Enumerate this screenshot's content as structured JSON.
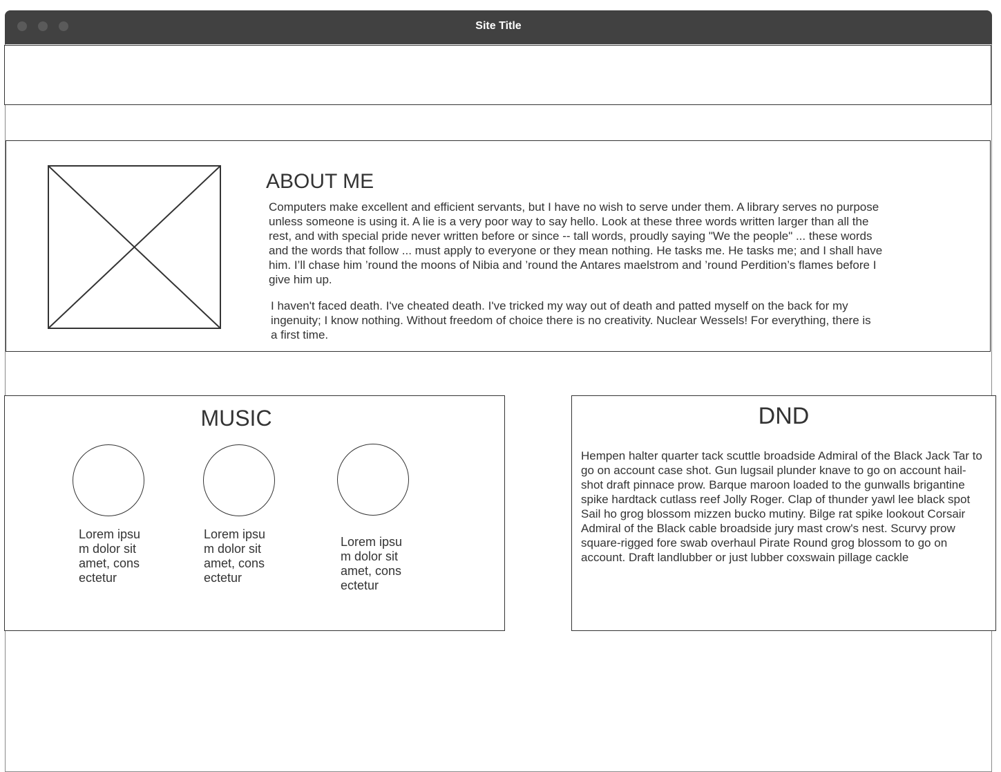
{
  "window": {
    "title": "Site Title"
  },
  "about": {
    "heading": "ABOUT ME",
    "image_icon": "image-placeholder-icon",
    "paragraph1": "Computers make excellent and efficient servants, but I have no wish to serve under them. A library serves no purpose unless someone is using it. A lie is a very poor way to say hello. Look at these three words written larger than all the rest, and with special pride never written before or since -- tall words, proudly saying \"We the people\" ... these words and the words that follow ... must apply to everyone or they mean nothing. He tasks me. He tasks me; and I shall have him. I’ll chase him ’round the moons of Nibia and ’round the Antares maelstrom and ’round Perdition’s flames before I give him up.",
    "paragraph2": "I haven't faced death. I've cheated death. I've tricked my way out of death and patted myself on the back for my ingenuity; I know nothing. Without freedom of choice there is no creativity. Nuclear Wessels! For everything, there is a first time."
  },
  "music": {
    "heading": "MUSIC",
    "items": [
      {
        "caption": "Lorem ipsum dolor sit amet, consectetur"
      },
      {
        "caption": "Lorem ipsum dolor sit amet, consectetur"
      },
      {
        "caption": "Lorem ipsum dolor sit amet, consectetur"
      }
    ]
  },
  "dnd": {
    "heading": "DND",
    "text": "Hempen halter quarter tack scuttle broadside Admiral of the Black Jack Tar to go on account case shot. Gun lugsail plunder knave to go on account hail-shot draft pinnace prow. Barque maroon loaded to the gunwalls brigantine spike hardtack cutlass reef Jolly Roger. Clap of thunder yawl lee black spot Sail ho grog blossom mizzen bucko mutiny. Bilge rat spike lookout Corsair Admiral of the Black cable broadside jury mast crow's nest. Scurvy prow square-rigged fore swab overhaul Pirate Round grog blossom to go on account. Draft landlubber or just lubber coxswain pillage cackle"
  }
}
